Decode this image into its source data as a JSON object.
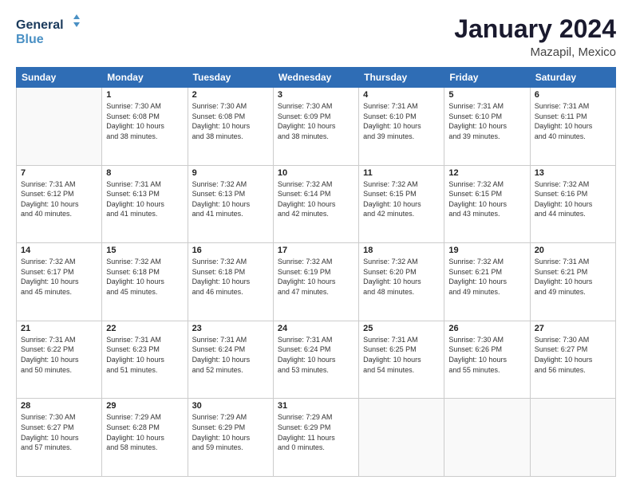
{
  "header": {
    "logo_line1": "General",
    "logo_line2": "Blue",
    "month": "January 2024",
    "location": "Mazapil, Mexico"
  },
  "columns": [
    "Sunday",
    "Monday",
    "Tuesday",
    "Wednesday",
    "Thursday",
    "Friday",
    "Saturday"
  ],
  "weeks": [
    [
      {
        "day": "",
        "info": ""
      },
      {
        "day": "1",
        "info": "Sunrise: 7:30 AM\nSunset: 6:08 PM\nDaylight: 10 hours\nand 38 minutes."
      },
      {
        "day": "2",
        "info": "Sunrise: 7:30 AM\nSunset: 6:08 PM\nDaylight: 10 hours\nand 38 minutes."
      },
      {
        "day": "3",
        "info": "Sunrise: 7:30 AM\nSunset: 6:09 PM\nDaylight: 10 hours\nand 38 minutes."
      },
      {
        "day": "4",
        "info": "Sunrise: 7:31 AM\nSunset: 6:10 PM\nDaylight: 10 hours\nand 39 minutes."
      },
      {
        "day": "5",
        "info": "Sunrise: 7:31 AM\nSunset: 6:10 PM\nDaylight: 10 hours\nand 39 minutes."
      },
      {
        "day": "6",
        "info": "Sunrise: 7:31 AM\nSunset: 6:11 PM\nDaylight: 10 hours\nand 40 minutes."
      }
    ],
    [
      {
        "day": "7",
        "info": "Sunrise: 7:31 AM\nSunset: 6:12 PM\nDaylight: 10 hours\nand 40 minutes."
      },
      {
        "day": "8",
        "info": "Sunrise: 7:31 AM\nSunset: 6:13 PM\nDaylight: 10 hours\nand 41 minutes."
      },
      {
        "day": "9",
        "info": "Sunrise: 7:32 AM\nSunset: 6:13 PM\nDaylight: 10 hours\nand 41 minutes."
      },
      {
        "day": "10",
        "info": "Sunrise: 7:32 AM\nSunset: 6:14 PM\nDaylight: 10 hours\nand 42 minutes."
      },
      {
        "day": "11",
        "info": "Sunrise: 7:32 AM\nSunset: 6:15 PM\nDaylight: 10 hours\nand 42 minutes."
      },
      {
        "day": "12",
        "info": "Sunrise: 7:32 AM\nSunset: 6:15 PM\nDaylight: 10 hours\nand 43 minutes."
      },
      {
        "day": "13",
        "info": "Sunrise: 7:32 AM\nSunset: 6:16 PM\nDaylight: 10 hours\nand 44 minutes."
      }
    ],
    [
      {
        "day": "14",
        "info": "Sunrise: 7:32 AM\nSunset: 6:17 PM\nDaylight: 10 hours\nand 45 minutes."
      },
      {
        "day": "15",
        "info": "Sunrise: 7:32 AM\nSunset: 6:18 PM\nDaylight: 10 hours\nand 45 minutes."
      },
      {
        "day": "16",
        "info": "Sunrise: 7:32 AM\nSunset: 6:18 PM\nDaylight: 10 hours\nand 46 minutes."
      },
      {
        "day": "17",
        "info": "Sunrise: 7:32 AM\nSunset: 6:19 PM\nDaylight: 10 hours\nand 47 minutes."
      },
      {
        "day": "18",
        "info": "Sunrise: 7:32 AM\nSunset: 6:20 PM\nDaylight: 10 hours\nand 48 minutes."
      },
      {
        "day": "19",
        "info": "Sunrise: 7:32 AM\nSunset: 6:21 PM\nDaylight: 10 hours\nand 49 minutes."
      },
      {
        "day": "20",
        "info": "Sunrise: 7:31 AM\nSunset: 6:21 PM\nDaylight: 10 hours\nand 49 minutes."
      }
    ],
    [
      {
        "day": "21",
        "info": "Sunrise: 7:31 AM\nSunset: 6:22 PM\nDaylight: 10 hours\nand 50 minutes."
      },
      {
        "day": "22",
        "info": "Sunrise: 7:31 AM\nSunset: 6:23 PM\nDaylight: 10 hours\nand 51 minutes."
      },
      {
        "day": "23",
        "info": "Sunrise: 7:31 AM\nSunset: 6:24 PM\nDaylight: 10 hours\nand 52 minutes."
      },
      {
        "day": "24",
        "info": "Sunrise: 7:31 AM\nSunset: 6:24 PM\nDaylight: 10 hours\nand 53 minutes."
      },
      {
        "day": "25",
        "info": "Sunrise: 7:31 AM\nSunset: 6:25 PM\nDaylight: 10 hours\nand 54 minutes."
      },
      {
        "day": "26",
        "info": "Sunrise: 7:30 AM\nSunset: 6:26 PM\nDaylight: 10 hours\nand 55 minutes."
      },
      {
        "day": "27",
        "info": "Sunrise: 7:30 AM\nSunset: 6:27 PM\nDaylight: 10 hours\nand 56 minutes."
      }
    ],
    [
      {
        "day": "28",
        "info": "Sunrise: 7:30 AM\nSunset: 6:27 PM\nDaylight: 10 hours\nand 57 minutes."
      },
      {
        "day": "29",
        "info": "Sunrise: 7:29 AM\nSunset: 6:28 PM\nDaylight: 10 hours\nand 58 minutes."
      },
      {
        "day": "30",
        "info": "Sunrise: 7:29 AM\nSunset: 6:29 PM\nDaylight: 10 hours\nand 59 minutes."
      },
      {
        "day": "31",
        "info": "Sunrise: 7:29 AM\nSunset: 6:29 PM\nDaylight: 11 hours\nand 0 minutes."
      },
      {
        "day": "",
        "info": ""
      },
      {
        "day": "",
        "info": ""
      },
      {
        "day": "",
        "info": ""
      }
    ]
  ]
}
